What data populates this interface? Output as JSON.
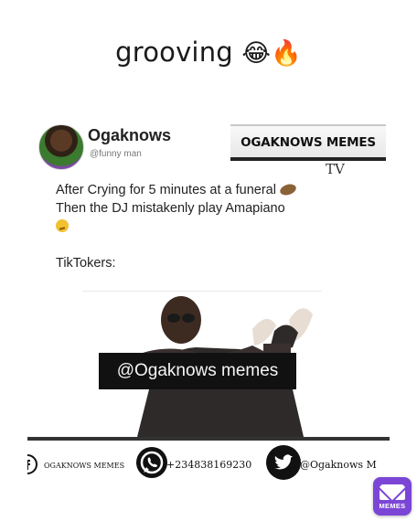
{
  "caption": {
    "text": "grooving",
    "emoji": "😂🔥"
  },
  "post": {
    "author_name": "Ogaknows",
    "author_handle": "@funny man",
    "lines": [
      "After Crying for 5 minutes at a funeral",
      "Then the DJ mistakenly play Amapiano",
      "TikTokers:"
    ]
  },
  "brand": {
    "title": "OGAKNOWS MEMES",
    "subtitle": "TV"
  },
  "watermark": "@Ogaknows memes",
  "social": {
    "facebook": "OGAKNOWS MEMES",
    "whatsapp": "+234838169230",
    "twitter": "@Ogaknows M"
  },
  "badge": {
    "label": "MEMES",
    "color": "#7b45d6"
  },
  "icons": [
    "facebook-icon",
    "whatsapp-icon",
    "twitter-icon",
    "potato-emoji-icon",
    "smirk-emoji-icon"
  ]
}
